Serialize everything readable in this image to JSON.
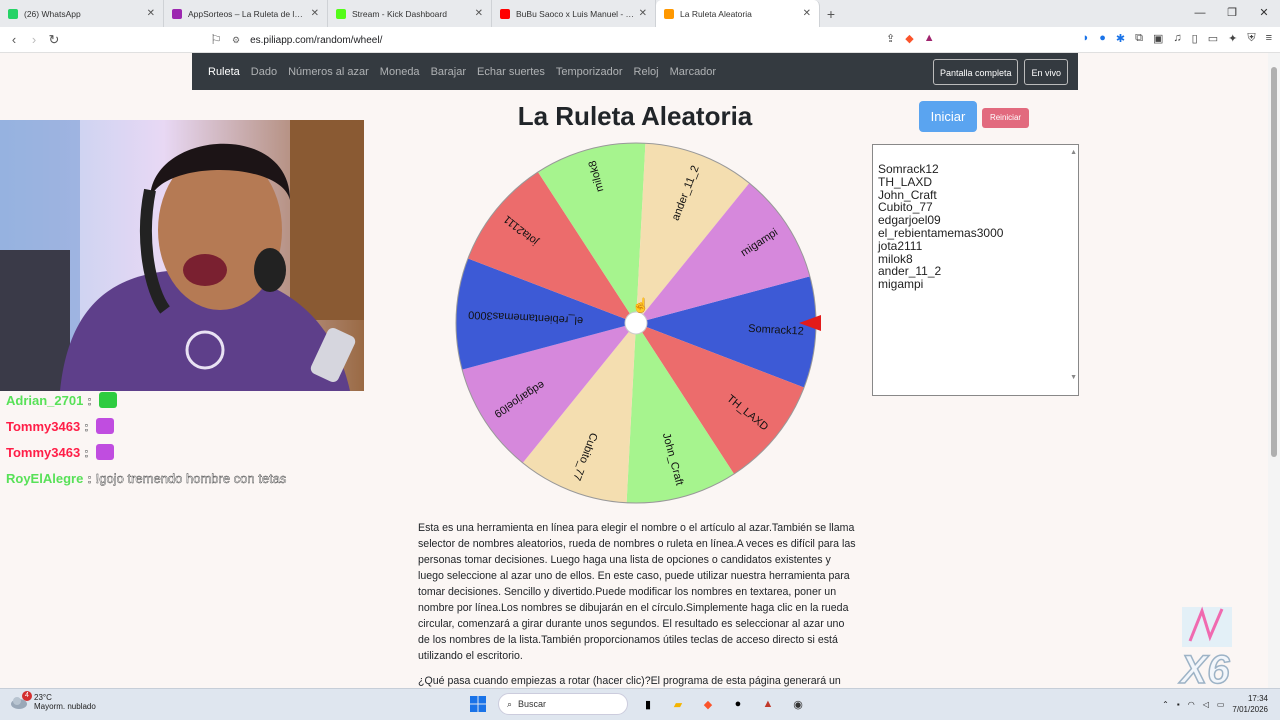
{
  "browser": {
    "tabs": [
      {
        "label": "(26) WhatsApp",
        "color": "#25d366"
      },
      {
        "label": "AppSorteos – La Ruleta de la Suerte",
        "color": "#9c27b0"
      },
      {
        "label": "Stream - Kick Dashboard",
        "color": "#53fc18"
      },
      {
        "label": "BuBu Saoco x Luis Manuel - TIMA",
        "color": "#ff0000"
      },
      {
        "label": "La Ruleta Aleatoria",
        "color": "#ff9800"
      }
    ],
    "url": "es.piliapp.com/random/wheel/"
  },
  "site_nav": {
    "items": [
      "Ruleta",
      "Dado",
      "Números al azar",
      "Moneda",
      "Barajar",
      "Echar suertes",
      "Temporizador",
      "Reloj",
      "Marcador"
    ],
    "fullscreen": "Pantalla completa",
    "live": "En vivo"
  },
  "page": {
    "title": "La Ruleta Aleatoria",
    "start_button": "Iniciar",
    "reset_button": "Reiniciar"
  },
  "wheel": {
    "segments": [
      {
        "name": "Somrack12",
        "color": "#3d5ad6"
      },
      {
        "name": "TH_LAXD",
        "color": "#ec6c6c"
      },
      {
        "name": "John_Craft",
        "color": "#a6f48e"
      },
      {
        "name": "Cubito_77",
        "color": "#f4deb0"
      },
      {
        "name": "edgarjoel09",
        "color": "#d688dc"
      },
      {
        "name": "el_rebientamemas3000",
        "color": "#3d5ad6"
      },
      {
        "name": "jota2111",
        "color": "#ec6c6c"
      },
      {
        "name": "milok8",
        "color": "#a6f48e"
      },
      {
        "name": "ander_11_2",
        "color": "#f4deb0"
      },
      {
        "name": "migampi",
        "color": "#d688dc"
      }
    ]
  },
  "names_list": {
    "lines": [
      "Somrack12",
      "TH_LAXD",
      "John_Craft",
      "Cubito_77",
      "edgarjoel09",
      "el_rebientamemas3000",
      "jota2111",
      "milok8",
      "ander_11_2",
      "migampi"
    ]
  },
  "description": {
    "paragraph": "Esta es una herramienta en línea para elegir el nombre o el artículo al azar.También se llama selector de nombres aleatorios, rueda de nombres o ruleta en línea.A veces es difícil para las personas tomar decisiones. Luego haga una lista de opciones o candidatos existentes y luego seleccione al azar uno de ellos. En este caso, puede utilizar nuestra herramienta para tomar decisiones. Sencillo y divertido.Puede modificar los nombres en textarea, poner un nombre por línea.Los nombres se dibujarán en el círculo.Simplemente haga clic en la rueda circular, comenzará a girar durante unos segundos. El resultado es seleccionar al azar uno de los nombres de la lista.También proporcionamos útiles teclas de acceso directo si está utilizando el escritorio.",
    "next_line": "¿Qué pasa cuando empiezas a rotar (hacer clic)?El programa de esta página generará un"
  },
  "chat": {
    "lines": [
      {
        "user": "Adrian_2701",
        "user_color": "#58e158",
        "msg": ""
      },
      {
        "user": "Tommy3463",
        "user_color": "#ff1e47",
        "msg": ""
      },
      {
        "user": "Tommy3463",
        "user_color": "#ff1e47",
        "msg": ""
      },
      {
        "user": "RoyElAlegre",
        "user_color": "#58e158",
        "msg": "!gojo tremendo hombre con tetas"
      }
    ]
  },
  "overlay": {
    "text": "X6"
  },
  "taskbar": {
    "temperature": "23°C",
    "weather": "Mayorm. nublado",
    "notifications": "4",
    "search_placeholder": "Buscar",
    "time": "17:34",
    "date": "7/01/2026"
  }
}
